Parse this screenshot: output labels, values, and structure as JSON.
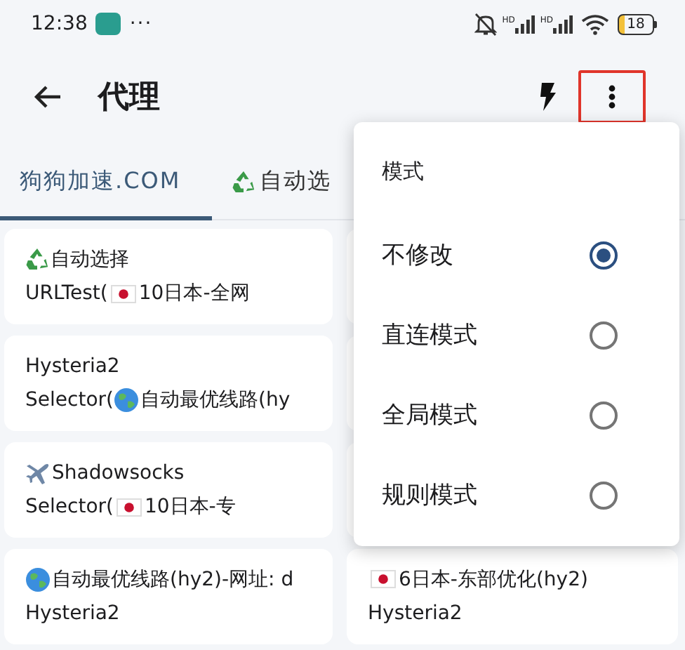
{
  "status_bar": {
    "time": "12:38",
    "more": "···",
    "network_labels": [
      "HD",
      "HD"
    ],
    "battery": "18"
  },
  "toolbar": {
    "title": "代理",
    "menu_highlighted": true
  },
  "tabs": [
    {
      "selected": true,
      "segments": [
        {
          "kind": "text",
          "text": "狗狗加速.COM"
        }
      ]
    },
    {
      "selected": false,
      "segments": [
        {
          "kind": "recycle"
        },
        {
          "kind": "text",
          "text": "自动选"
        }
      ]
    }
  ],
  "cards": [
    {
      "kind": "node",
      "lines": [
        [
          {
            "kind": "recycle"
          },
          {
            "kind": "text",
            "text": "自动选择"
          }
        ],
        [
          {
            "kind": "text",
            "text": "URLTest("
          },
          {
            "kind": "flag"
          },
          {
            "kind": "text",
            "text": "10日本-全网"
          }
        ]
      ]
    },
    {
      "kind": "covered"
    },
    {
      "kind": "node",
      "lines": [
        [
          {
            "kind": "text",
            "text": "Hysteria2"
          }
        ],
        [
          {
            "kind": "text",
            "text": "Selector("
          },
          {
            "kind": "globe"
          },
          {
            "kind": "text",
            "text": "自动最优线路(hy"
          }
        ]
      ]
    },
    {
      "kind": "covered"
    },
    {
      "kind": "node",
      "lines": [
        [
          {
            "kind": "plane"
          },
          {
            "kind": "text",
            "text": "Shadowsocks"
          }
        ],
        [
          {
            "kind": "text",
            "text": "Selector("
          },
          {
            "kind": "flag"
          },
          {
            "kind": "text",
            "text": "10日本-专"
          }
        ]
      ]
    },
    {
      "kind": "covered"
    },
    {
      "kind": "node",
      "lines": [
        [
          {
            "kind": "globe"
          },
          {
            "kind": "text",
            "text": "自动最优线路(hy2)-网址: d"
          }
        ],
        [
          {
            "kind": "text",
            "text": "Hysteria2"
          }
        ]
      ]
    },
    {
      "kind": "node",
      "lines": [
        [
          {
            "kind": "flag"
          },
          {
            "kind": "text",
            "text": "6日本-东部优化(hy2)"
          }
        ],
        [
          {
            "kind": "text",
            "text": "Hysteria2"
          }
        ]
      ]
    }
  ],
  "menu": {
    "title": "模式",
    "options": [
      {
        "label": "不修改",
        "selected": true
      },
      {
        "label": "直连模式",
        "selected": false
      },
      {
        "label": "全局模式",
        "selected": false
      },
      {
        "label": "规则模式",
        "selected": false
      }
    ]
  }
}
